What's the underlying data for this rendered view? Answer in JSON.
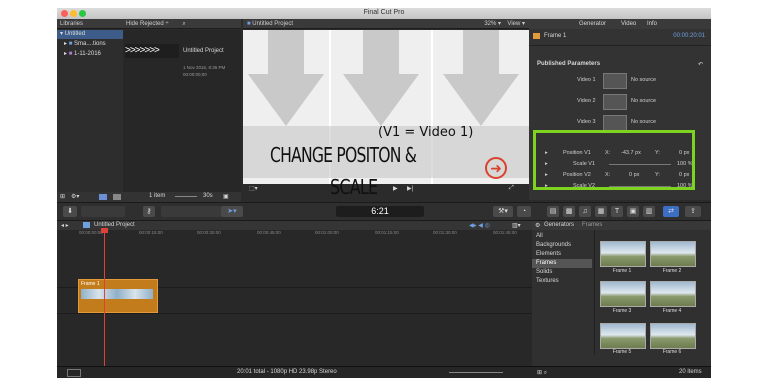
{
  "window": {
    "title": "Final Cut Pro"
  },
  "libraries": {
    "header": "Libraries",
    "items": [
      "Untitled",
      "Sma....tions",
      "1-11-2016"
    ]
  },
  "browser": {
    "filter": "Hide Rejected ÷",
    "clip_title": "Untitled Project",
    "clip_date": "1 Nov 2016, 8:36 PM",
    "clip_tc": "00:00:00;00",
    "item_count": "1 item",
    "duration": "30s"
  },
  "viewer": {
    "title": "Untitled Project",
    "zoom": "32% ▾",
    "view": "View ▾",
    "timecode": "6:21"
  },
  "overlay": {
    "note": "(V1 = Video 1)",
    "headline_line1": "CHANGE POSITON &",
    "headline_line2": "SCALE"
  },
  "inspector": {
    "tabs": [
      "Generator",
      "Video",
      "Info"
    ],
    "clip_name": "Frame 1",
    "clip_tc": "00:00:20:01",
    "published": "Published Parameters",
    "videos": [
      {
        "label": "Video 1",
        "value": "No source"
      },
      {
        "label": "Video 2",
        "value": "No source"
      },
      {
        "label": "Video 3",
        "value": "No source"
      }
    ],
    "params": [
      {
        "label": "Position V1",
        "x_label": "X:",
        "x": "-43.7 px",
        "y_label": "Y:",
        "y": "0 px"
      },
      {
        "label": "Scale V1",
        "value": "100 %"
      },
      {
        "label": "Position V2",
        "x_label": "X:",
        "x": "0 px",
        "y_label": "Y:",
        "y": "0 px"
      },
      {
        "label": "Scale V2",
        "value": "100 %"
      }
    ]
  },
  "timeline": {
    "title": "Untitled Project",
    "ticks": [
      "00:00:00:00",
      "00:00:15:00",
      "00:00:30:00",
      "00:00:45:00",
      "00:01:00:00",
      "00:01:15:00",
      "00:01:30:00",
      "00:01:45:00"
    ],
    "clip_label": "Frame 1"
  },
  "generators": {
    "header": "Generators",
    "sub": "Frames",
    "categories": [
      "All",
      "Backgrounds",
      "Elements",
      "Frames",
      "Solids",
      "Textures"
    ],
    "selected_category": "Frames",
    "thumbs": [
      "Frame 1",
      "Frame 2",
      "Frame 3",
      "Frame 4",
      "Frame 5",
      "Frame 6"
    ],
    "count": "20 items"
  },
  "status": {
    "text": "20:01 total - 1080p HD 23.98p Stereo"
  },
  "colors": {
    "accent_green": "#7ed321",
    "clip_orange": "#c37c1c",
    "record_red": "#d9432e"
  }
}
